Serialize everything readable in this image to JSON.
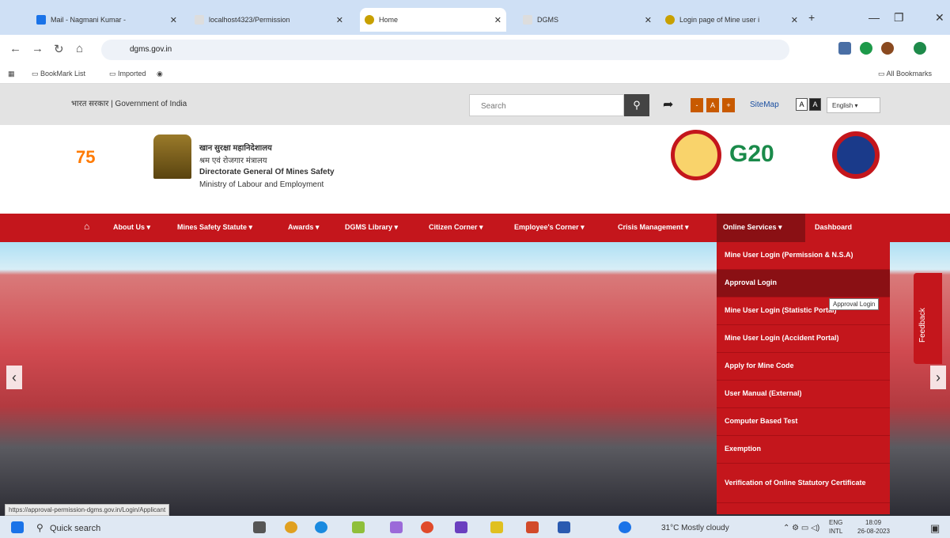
{
  "browser": {
    "tabs": [
      {
        "label": "Mail - Nagmani Kumar - ",
        "color": "#1a73e8"
      },
      {
        "label": "localhost4323/Permission",
        "color": "#ffffff"
      },
      {
        "label": "Home",
        "color": "#c8a000"
      },
      {
        "label": "DGMS",
        "color": "#ffffff"
      },
      {
        "label": "Login page of Mine user i",
        "color": "#c8a000"
      }
    ],
    "new_tab": "+",
    "url": "dgms.gov.in",
    "bookmarks": [
      "BookMark List",
      "Imported"
    ],
    "all_bookmarks": "All Bookmarks"
  },
  "gov": {
    "label": "भारत सरकार | Government of India",
    "search_placeholder": "Search",
    "font_buttons": [
      "-",
      "A",
      "+"
    ],
    "sitemap": "SiteMap",
    "contrast": [
      "A",
      "A"
    ],
    "language": "English"
  },
  "header": {
    "hindi_title": "खान सुरक्षा महानिदेशालय",
    "hindi_sub": "श्रम एवं रोजगार मंत्रालय",
    "title": "Directorate General Of Mines Safety",
    "ministry": "Ministry of Labour and Employment",
    "amrit": "75",
    "g20": "G20"
  },
  "menu": [
    {
      "label": "About Us ▾"
    },
    {
      "label": "Mines Safety Statute ▾"
    },
    {
      "label": "Awards ▾"
    },
    {
      "label": "DGMS Library ▾"
    },
    {
      "label": "Citizen Corner ▾"
    },
    {
      "label": "Employee's Corner ▾"
    },
    {
      "label": "Crisis Management ▾"
    },
    {
      "label": "Online Services ▾"
    },
    {
      "label": "Dashboard"
    }
  ],
  "dropdown": [
    "Mine User Login (Permission & N.S.A)",
    "Approval Login",
    "Mine User Login (Statistic Portal)",
    "Mine User Login (Accident Portal)",
    "Apply for Mine Code",
    "User Manual (External)",
    "Computer Based Test",
    "Exemption",
    "Verification of Online Statutory Certificate"
  ],
  "tooltip": "Approval Login",
  "feedback": "Feedback",
  "status_url": "https://approval-permission-dgms.gov.in/Login/Applicant",
  "taskbar": {
    "search": "Quick search",
    "weather": "31°C  Mostly cloudy",
    "lang": "ENG",
    "lang2": "INTL",
    "time": "18:09",
    "date": "26-08-2023"
  }
}
